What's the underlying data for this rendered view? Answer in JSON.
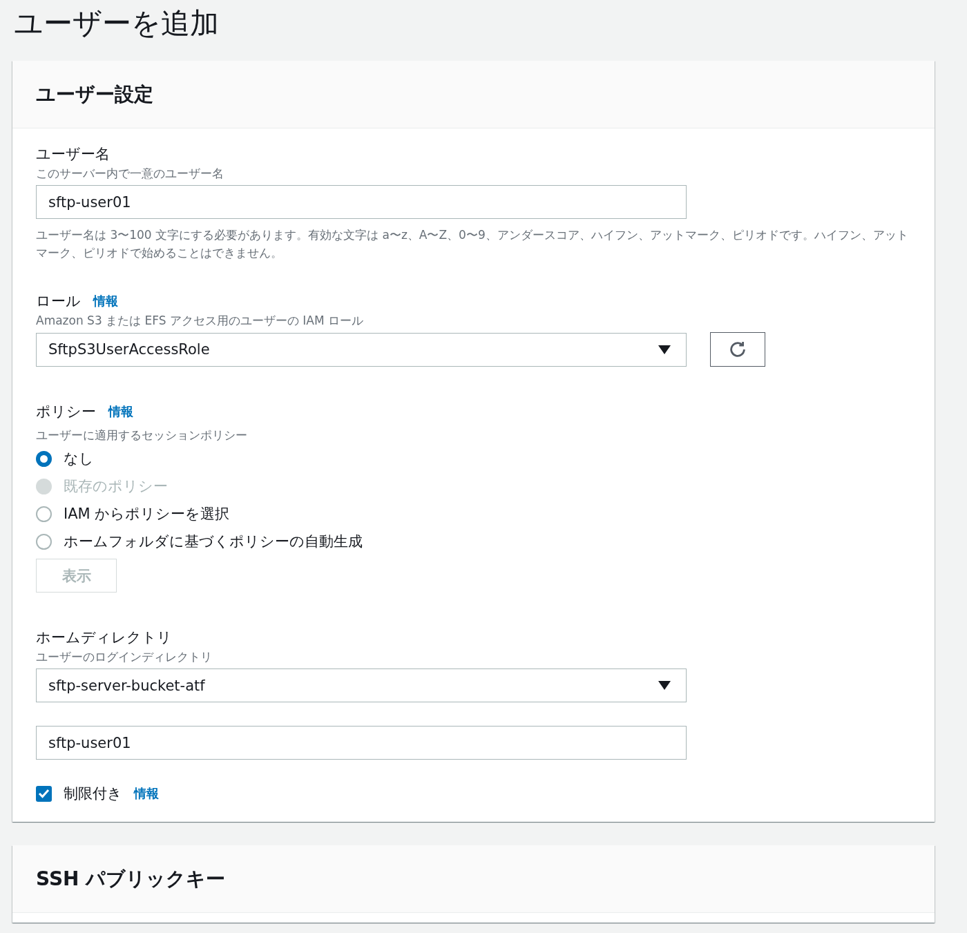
{
  "title": "ユーザーを追加",
  "user_settings": {
    "heading": "ユーザー設定",
    "username": {
      "label": "ユーザー名",
      "description": "このサーバー内で一意のユーザー名",
      "value": "sftp-user01",
      "hint": "ユーザー名は 3〜100 文字にする必要があります。有効な文字は a〜z、A〜Z、0〜9、アンダースコア、ハイフン、アットマーク、ピリオドです。ハイフン、アットマーク、ピリオドで始めることはできません。"
    },
    "role": {
      "label": "ロール",
      "info": "情報",
      "description": "Amazon S3 または EFS アクセス用のユーザーの IAM ロール",
      "value": "SftpS3UserAccessRole"
    },
    "policy": {
      "label": "ポリシー",
      "info": "情報",
      "description": "ユーザーに適用するセッションポリシー",
      "options": [
        {
          "label": "なし",
          "selected": true,
          "disabled": false
        },
        {
          "label": "既存のポリシー",
          "selected": false,
          "disabled": true
        },
        {
          "label": "IAM からポリシーを選択",
          "selected": false,
          "disabled": false
        },
        {
          "label": "ホームフォルダに基づくポリシーの自動生成",
          "selected": false,
          "disabled": false
        }
      ],
      "view_button": {
        "label": "表示",
        "disabled": true
      }
    },
    "home_directory": {
      "label": "ホームディレクトリ",
      "description": "ユーザーのログインディレクトリ",
      "bucket": "sftp-server-bucket-atf",
      "path": "sftp-user01"
    },
    "restricted": {
      "label": "制限付き",
      "checked": true,
      "info": "情報"
    }
  },
  "ssh_section": {
    "heading": "SSH パブリックキー"
  }
}
